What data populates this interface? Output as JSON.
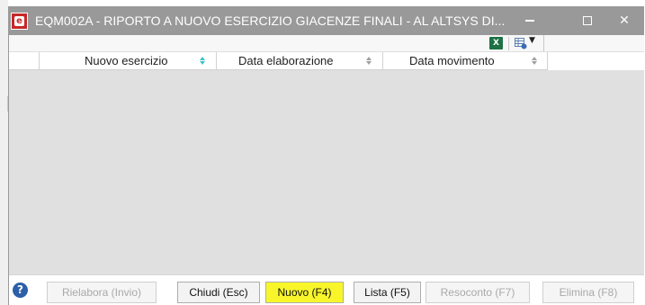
{
  "window": {
    "title": "EQM002A - RIPORTO A NUOVO ESERCIZIO GIACENZE FINALI - AL ALTSYS DI...",
    "app_icon": "app-logo-icon",
    "controls": {
      "minimize": "minimize-icon",
      "maximize": "maximize-icon",
      "close": "✕"
    }
  },
  "toolbar": {
    "excel_icon_text": "X",
    "icons": [
      "excel-export-icon",
      "grid-settings-icon",
      "chevron-down-icon"
    ]
  },
  "grid": {
    "columns": [
      {
        "label": "Nuovo esercizio",
        "sort": "active"
      },
      {
        "label": "Data elaborazione",
        "sort": "none"
      },
      {
        "label": "Data movimento",
        "sort": "none"
      }
    ],
    "rows": []
  },
  "footer": {
    "help_icon_text": "?",
    "buttons": [
      {
        "label": "Rielabora (Invio)",
        "state": "disabled"
      },
      {
        "label": "Chiudi (Esc)",
        "state": "enabled"
      },
      {
        "label": "Nuovo (F4)",
        "state": "highlighted"
      },
      {
        "label": "Lista (F5)",
        "state": "enabled"
      },
      {
        "label": "Resoconto (F7)",
        "state": "disabled"
      },
      {
        "label": "Elimina (F8)",
        "state": "disabled"
      }
    ]
  },
  "colors": {
    "titlebar": "#999999",
    "grid_body": "#e0e0e0",
    "sort_active": "#3cc3c8",
    "highlight": "#f8f62a"
  }
}
